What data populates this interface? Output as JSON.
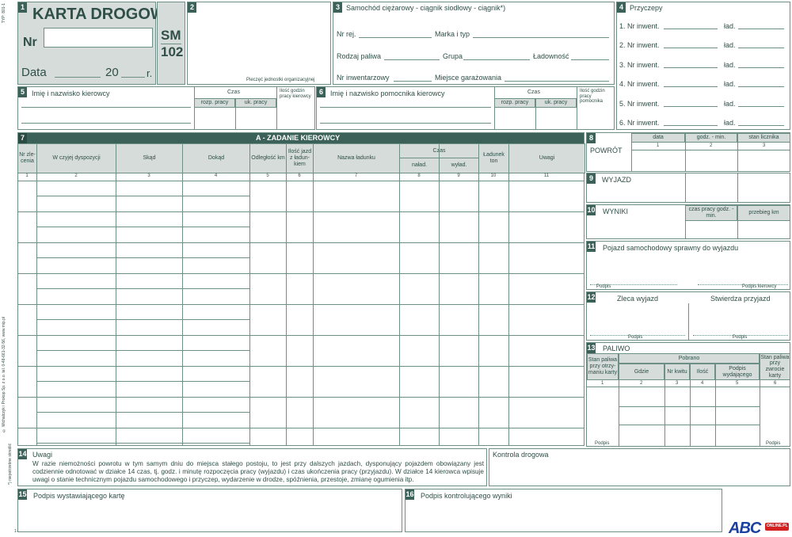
{
  "side": {
    "typ": "TYP: 801-1",
    "vertical": "© Michalczyk i Prokop Sp. z o.o. tel. 0-48-661-32-56, www.mip.pl",
    "note1": "*) niepotrzebne skreślić",
    "code": "1-dd/G"
  },
  "s1": {
    "num": "1",
    "title": "KARTA DROGOWA",
    "nr": "Nr",
    "data_label": "Data",
    "year": "20",
    "r": "r."
  },
  "sm": {
    "a": "SM",
    "b": "102"
  },
  "s2": {
    "num": "2",
    "stamp": "Pieczęć jednostki organizacyjnej"
  },
  "s3": {
    "num": "3",
    "title": "Samochód ciężarowy - ciągnik siodłowy - ciągnik*)",
    "nr_rej": "Nr rej.",
    "marka": "Marka i typ",
    "paliwo": "Rodzaj paliwa",
    "grupa": "Grupa",
    "ladownosc": "Ładowność",
    "inwent": "Nr inwentarzowy",
    "miejsce": "Miejsce garażowania"
  },
  "s4": {
    "num": "4",
    "title": "Przyczepy",
    "rows": [
      "1. Nr inwent.",
      "2. Nr inwent.",
      "3. Nr inwent.",
      "4. Nr inwent.",
      "5. Nr inwent.",
      "6. Nr inwent."
    ],
    "lad": "ład."
  },
  "s5": {
    "num": "5",
    "title": "Imię i nazwisko kierowcy",
    "czas": "Czas",
    "rozp": "rozp. pracy",
    "uk": "uk. pracy",
    "ilosc": "Ilość godzin pracy kierowcy"
  },
  "s6": {
    "num": "6",
    "title": "Imię i nazwisko pomocnika kierowcy",
    "czas": "Czas",
    "rozp": "rozp. pracy",
    "uk": "uk. pracy",
    "ilosc": "Ilość godzin pracy pomocnika"
  },
  "s7": {
    "num": "7",
    "title": "A - ZADANIE KIEROWCY",
    "cols": [
      "Nr zle-cenia",
      "W czyjej dyspozycji",
      "Skąd",
      "Dokąd",
      "Odległość km",
      "Ilość jazd z ładun-kiem",
      "Nazwa ładunku",
      "naład.",
      "wyład.",
      "Ładunek ton",
      "Uwagi"
    ],
    "czas": "Czas",
    "nums": [
      "1",
      "2",
      "3",
      "4",
      "5",
      "6",
      "7",
      "8",
      "9",
      "10",
      "11"
    ]
  },
  "s8": {
    "num": "8",
    "title": "POWRÓT",
    "data": "data",
    "godz": "godz. - min.",
    "stan": "stan licznika",
    "nums": [
      "1",
      "2",
      "3"
    ]
  },
  "s9": {
    "num": "9",
    "title": "WYJAZD"
  },
  "s10": {
    "num": "10",
    "title": "WYNIKI",
    "czas": "czas pracy godz. - min.",
    "przebieg": "przebieg km"
  },
  "s11": {
    "num": "11",
    "title": "Pojazd samochodowy sprawny do wyjazdu",
    "podpis": "Podpis",
    "podpis_k": "Podpis kierowcy"
  },
  "s12": {
    "num": "12",
    "zleca": "Zleca wyjazd",
    "stwierdza": "Stwierdza przyjazd",
    "podpis1": "Podpis",
    "podpis2": "Podpis"
  },
  "s13": {
    "num": "13",
    "title": "PALIWO",
    "stan1": "Stan paliwa przy otrzy-maniu karty",
    "pobrano": "Pobrano",
    "gdzie": "Gdzie",
    "nrkw": "Nr kwitu",
    "ilosc": "Ilość",
    "podpis_w": "Podpis wydającego",
    "stan2": "Stan paliwa przy zwrocie karty",
    "nums": [
      "1",
      "2",
      "3",
      "4",
      "5",
      "6"
    ],
    "podpis1": "Podpis",
    "podpis2": "Podpis"
  },
  "s14": {
    "num": "14",
    "title": "Uwagi",
    "text": "W razie niemożności powrotu w tym samym dniu do miejsca stałego postoju, to jest przy dalszych jazdach, dysponujący pojazdem obowiązany jest codziennie odnotować w działce 14 czas, tj. godz. i minutę rozpoczęcia pracy (wyjazdu) i czas ukończenia pracy (przyjazdu). W działce 14 kierowca wpisuje uwagi o stanie technicznym pojazdu samochodowego i przyczep, wydarzenie w drodze, spóźnienia, przestoje, zmianę ogumienia itp.",
    "kontrola": "Kontrola drogowa"
  },
  "s15": {
    "num": "15",
    "title": "Podpis wystawiającego kartę"
  },
  "s16": {
    "num": "16",
    "title": "Podpis kontrolującego wyniki"
  },
  "logo": {
    "text": "ABC",
    "sub": "ONLINE.PL"
  }
}
